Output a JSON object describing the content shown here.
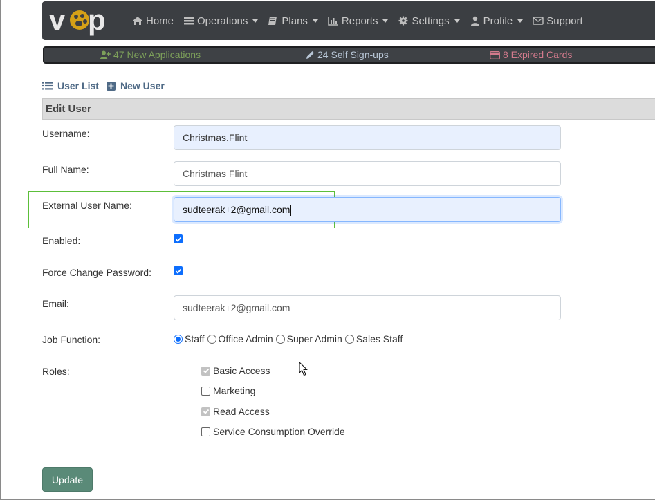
{
  "brand": {
    "logo_text": "vcp"
  },
  "nav": {
    "items": [
      {
        "label": "Home",
        "icon": "home-icon",
        "has_caret": false
      },
      {
        "label": "Operations",
        "icon": "list-icon",
        "has_caret": true
      },
      {
        "label": "Plans",
        "icon": "book-icon",
        "has_caret": true
      },
      {
        "label": "Reports",
        "icon": "bar-chart-icon",
        "has_caret": true
      },
      {
        "label": "Settings",
        "icon": "gear-icon",
        "has_caret": true
      },
      {
        "label": "Profile",
        "icon": "user-icon",
        "has_caret": true
      },
      {
        "label": "Support",
        "icon": "envelope-icon",
        "has_caret": false
      }
    ]
  },
  "notifications": {
    "applications": "47 New Applications",
    "self_signups": "24 Self Sign-ups",
    "expired_cards": "8 Expired Cards"
  },
  "subnav": {
    "user_list": "User List",
    "new_user": "New User"
  },
  "section": {
    "title": "Edit User"
  },
  "form": {
    "username_label": "Username:",
    "username_value": "Christmas.Flint",
    "fullname_label": "Full Name:",
    "fullname_value": "Christmas Flint",
    "external_label": "External User Name:",
    "external_value": "sudteerak+2@gmail.com",
    "enabled_label": "Enabled:",
    "enabled_checked": true,
    "force_label": "Force Change Password:",
    "force_checked": true,
    "email_label": "Email:",
    "email_value": "sudteerak+2@gmail.com",
    "job_label": "Job Function:",
    "job_options": [
      "Staff",
      "Office Admin",
      "Super Admin",
      "Sales Staff"
    ],
    "job_selected": "Staff",
    "roles_label": "Roles:",
    "roles": [
      {
        "label": "Basic Access",
        "checked": true,
        "disabled": true
      },
      {
        "label": "Marketing",
        "checked": false,
        "disabled": false
      },
      {
        "label": "Read Access",
        "checked": true,
        "disabled": true
      },
      {
        "label": "Service Consumption Override",
        "checked": false,
        "disabled": false
      }
    ],
    "update_button": "Update"
  },
  "colors": {
    "navbar_bg": "#3b3e42",
    "notif_apps": "#7da05a",
    "notif_self": "#b8c6d6",
    "notif_expired": "#d27a8c",
    "link": "#4f6a86",
    "checkbox": "#0d6efd",
    "update_button": "#5a8a78",
    "highlight": "#5cbf3a"
  }
}
